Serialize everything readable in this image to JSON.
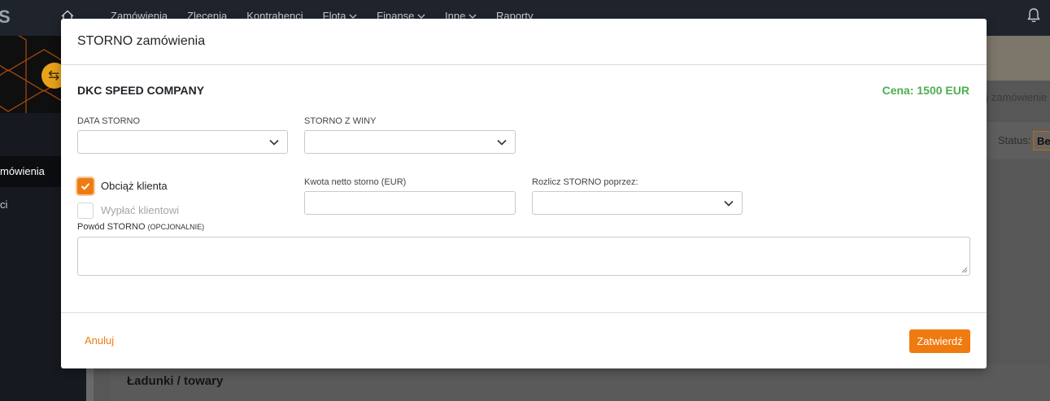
{
  "app": {
    "logo_text": "S",
    "nav": [
      {
        "label": "Zamówienia"
      },
      {
        "label": "Zlecenia"
      },
      {
        "label": "Kontrahenci"
      },
      {
        "label": "Flota",
        "dropdown": true
      },
      {
        "label": "Finanse",
        "dropdown": true
      },
      {
        "label": "Inne",
        "dropdown": true
      },
      {
        "label": "Raporty"
      }
    ],
    "sidebar": {
      "items": [
        {
          "label": "mówienia",
          "active": true
        },
        {
          "label": "ci",
          "active": false
        }
      ]
    },
    "background": {
      "link_text": "uj zamówienie",
      "status_label": "Status:",
      "status_value": "Be",
      "section_title": "Ładunki / towary"
    }
  },
  "modal": {
    "title": "STORNO zamówienia",
    "company": "DKC SPEED COMPANY",
    "price": "Cena: 1500 EUR",
    "fields": {
      "data_storno": {
        "label": "DATA STORNO",
        "value": ""
      },
      "storno_z_winy": {
        "label": "STORNO Z WINY",
        "value": ""
      },
      "kwota_netto": {
        "label": "Kwota netto storno (EUR)",
        "value": ""
      },
      "rozlicz": {
        "label": "Rozlicz STORNO poprzez:",
        "value": ""
      },
      "powod": {
        "label": "Powód STORNO",
        "label_suffix": "(OPCJONALNIE)",
        "value": ""
      }
    },
    "checkboxes": {
      "obciaz": {
        "label": "Obciąż klienta",
        "checked": true
      },
      "wyplac": {
        "label": "Wypłać klientowi",
        "checked": false,
        "disabled": true
      }
    },
    "footer": {
      "cancel_label": "Anuluj",
      "confirm_label": "Zatwierdź"
    }
  },
  "colors": {
    "accent": "#ef7b10",
    "price_green": "#4caf50",
    "topbar": "#1f242c"
  }
}
